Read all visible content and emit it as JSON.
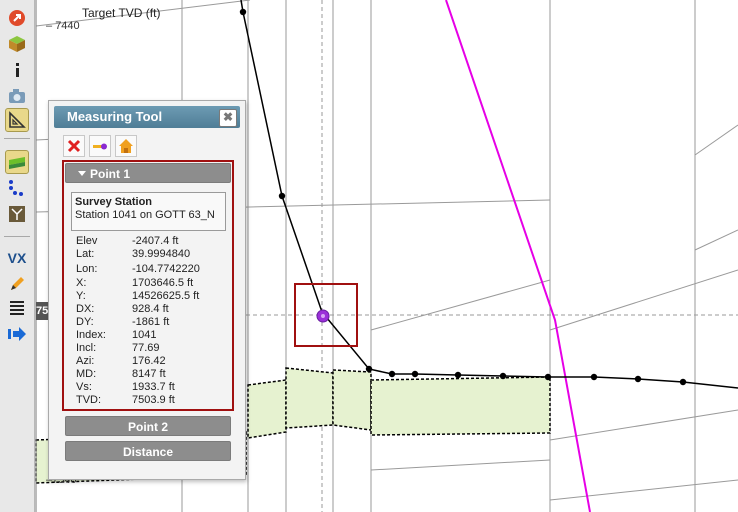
{
  "plot": {
    "axis_title": "Target TVD (ft)",
    "ticks": {
      "top": "7440",
      "badge": "75",
      "bottom": "7540"
    },
    "colors": {
      "well_path": "#000000",
      "offset_well": "#e600e6",
      "formation_fill": "#e6f2d0",
      "selection_marker": "#9b30d9",
      "selection_box": "#a01010"
    }
  },
  "toolbar": {
    "items": [
      {
        "icon": "pin-icon"
      },
      {
        "icon": "cube-icon"
      },
      {
        "icon": "info-icon"
      },
      {
        "icon": "camera-icon"
      },
      {
        "icon": "ruler-triangle-icon",
        "active": true
      },
      {
        "icon": "layers-icon"
      },
      {
        "icon": "points-icon"
      },
      {
        "icon": "grid-icon"
      },
      {
        "icon": "vx-icon",
        "label": "VX"
      },
      {
        "icon": "pencil-icon"
      },
      {
        "icon": "lines-icon"
      },
      {
        "icon": "export-arrow-icon"
      }
    ]
  },
  "measuring_tool": {
    "title": "Measuring Tool",
    "close_label": "✖",
    "tool_icons": [
      "clear-x-icon",
      "measure-line-icon",
      "home-icon"
    ],
    "point1": {
      "label": "Point 1",
      "station_title": "Survey Station",
      "station_desc": "Station 1041 on GOTT 63_N",
      "attributes": [
        {
          "key": "Elev",
          "value": "-2407.4 ft"
        },
        {
          "key": "Lat:",
          "value": "39.9994840"
        },
        {
          "key": "Lon:",
          "value": "-104.7742220"
        },
        {
          "key": "X:",
          "value": "1703646.5 ft"
        },
        {
          "key": "Y:",
          "value": "14526625.5 ft"
        },
        {
          "key": "DX:",
          "value": "928.4 ft"
        },
        {
          "key": "DY:",
          "value": "-1861 ft"
        },
        {
          "key": "Index:",
          "value": "1041"
        },
        {
          "key": "Incl:",
          "value": "77.69"
        },
        {
          "key": "Azi:",
          "value": "176.42"
        },
        {
          "key": "MD:",
          "value": "8147 ft"
        },
        {
          "key": "Vs:",
          "value": "1933.7 ft"
        },
        {
          "key": "TVD:",
          "value": "7503.9 ft"
        }
      ]
    },
    "point2_label": "Point 2",
    "distance_label": "Distance"
  }
}
